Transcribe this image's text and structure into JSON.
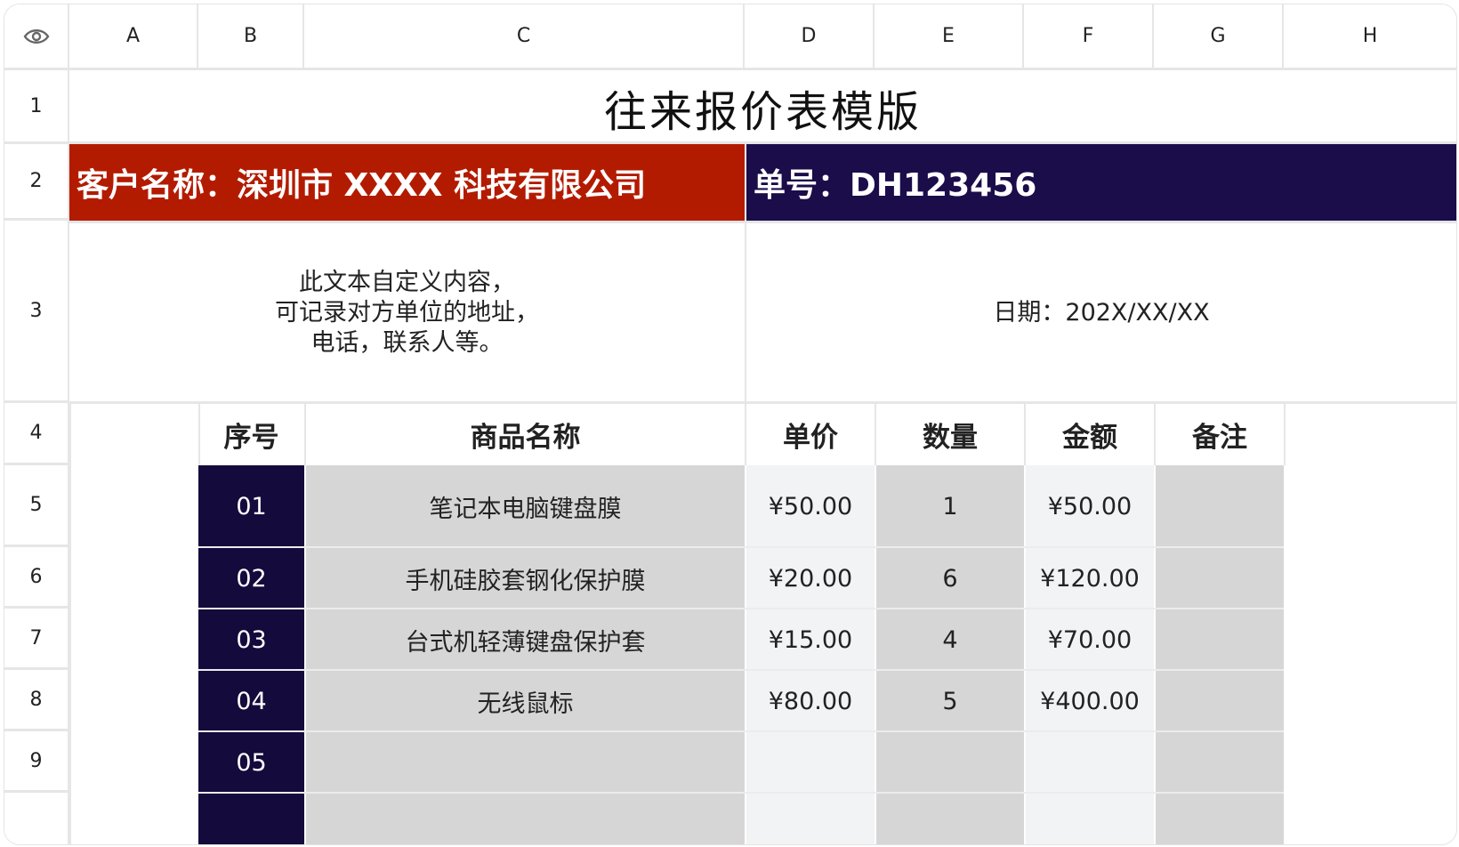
{
  "columns": [
    "A",
    "B",
    "C",
    "D",
    "E",
    "F",
    "G",
    "H"
  ],
  "rows": [
    "1",
    "2",
    "3",
    "4",
    "5",
    "6",
    "7",
    "8",
    "9"
  ],
  "title": "往来报价表模版",
  "customer_label": "客户名称：深圳市 XXXX 科技有限公司",
  "order_label": "单号：DH123456",
  "info_text": [
    "此文本自定义内容，",
    "可记录对方单位的地址，",
    "电话，联系人等。"
  ],
  "date_label": "日期：202X/XX/XX",
  "table": {
    "headers": [
      "序号",
      "商品名称",
      "单价",
      "数量",
      "金额",
      "备注"
    ],
    "rows": [
      {
        "seq": "01",
        "name": "笔记本电脑键盘膜",
        "price": "¥50.00",
        "qty": "1",
        "amount": "¥50.00",
        "note": ""
      },
      {
        "seq": "02",
        "name": "手机硅胶套钢化保护膜",
        "price": "¥20.00",
        "qty": "6",
        "amount": "¥120.00",
        "note": ""
      },
      {
        "seq": "03",
        "name": "台式机轻薄键盘保护套",
        "price": "¥15.00",
        "qty": "4",
        "amount": "¥70.00",
        "note": ""
      },
      {
        "seq": "04",
        "name": "无线鼠标",
        "price": "¥80.00",
        "qty": "5",
        "amount": "¥400.00",
        "note": ""
      },
      {
        "seq": "05",
        "name": "",
        "price": "",
        "qty": "",
        "amount": "",
        "note": ""
      }
    ]
  },
  "colors": {
    "red": "#b31b00",
    "navy": "#1b0c4a",
    "seq": "#150a3c",
    "gray": "#d6d6d6",
    "light": "#f2f3f5"
  },
  "icons": {
    "corner": "eye-icon"
  }
}
